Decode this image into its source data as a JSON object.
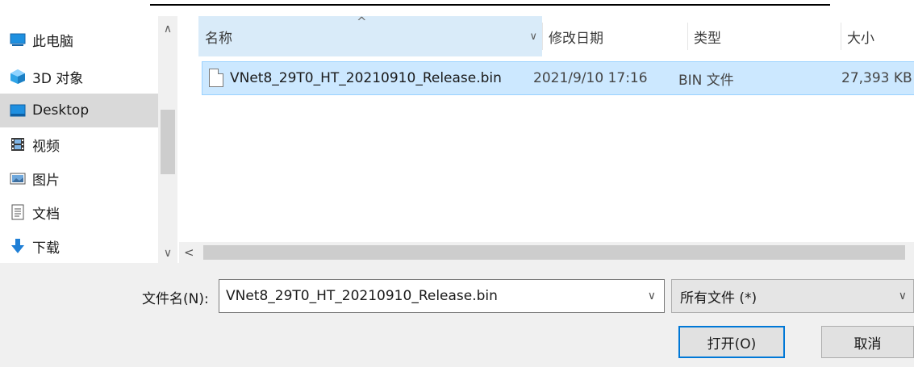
{
  "nav": {
    "items": [
      {
        "label": "此电脑",
        "icon": "computer-icon",
        "selected": false
      },
      {
        "label": "3D 对象",
        "icon": "3d-objects-icon",
        "selected": false
      },
      {
        "label": "Desktop",
        "icon": "desktop-icon",
        "selected": true
      },
      {
        "label": "视频",
        "icon": "video-icon",
        "selected": false
      },
      {
        "label": "图片",
        "icon": "pictures-icon",
        "selected": false
      },
      {
        "label": "文档",
        "icon": "documents-icon",
        "selected": false
      },
      {
        "label": "下载",
        "icon": "downloads-icon",
        "selected": false
      }
    ]
  },
  "columns": {
    "name": "名称",
    "modified": "修改日期",
    "type": "类型",
    "size": "大小"
  },
  "files": [
    {
      "name": "VNet8_29T0_HT_20210910_Release.bin",
      "modified": "2021/9/10 17:16",
      "type": "BIN 文件",
      "size": "27,393 KB",
      "selected": true
    }
  ],
  "footer": {
    "filename_label": "文件名(N):",
    "filename_value": "VNet8_29T0_HT_20210910_Release.bin",
    "filetype_value": "所有文件 (*)",
    "open_label": "打开(O)",
    "cancel_label": "取消"
  },
  "colors": {
    "selection": "#cce8ff",
    "accent": "#0078d7"
  }
}
